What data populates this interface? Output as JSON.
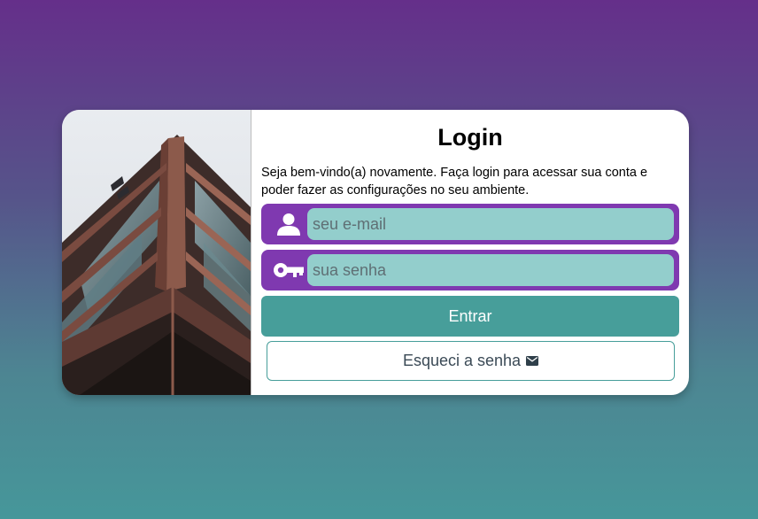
{
  "login": {
    "title": "Login",
    "welcome_text": "Seja bem-vindo(a) novamente. Faça login para acessar sua conta e poder fazer as configurações no seu ambiente.",
    "email_placeholder": "seu e-mail",
    "email_value": "",
    "email_icon": "user-icon",
    "password_placeholder": "sua senha",
    "password_value": "",
    "password_icon": "key-icon",
    "enter_label": "Entrar",
    "forgot_label": "Esqueci a senha",
    "forgot_icon": "envelope-icon",
    "image": "building-photo"
  },
  "colors": {
    "background_top": "#652f8a",
    "background_bottom": "#46979a",
    "field_frame": "#7f39b0",
    "field_input": "#93cecc",
    "primary_button": "#479e9a",
    "card": "#ffffff"
  }
}
